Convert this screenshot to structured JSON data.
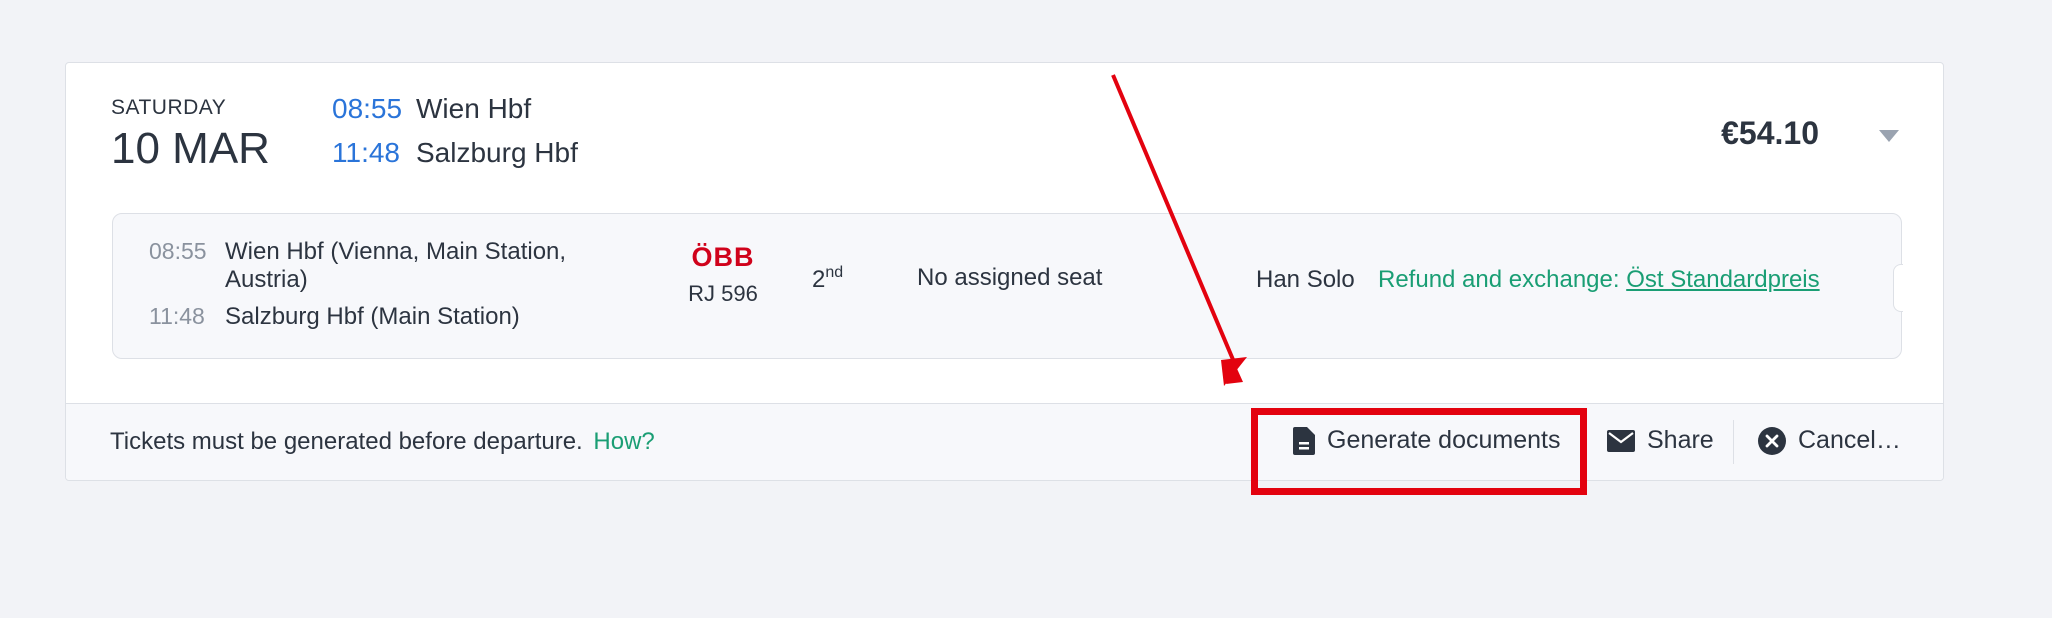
{
  "trip": {
    "weekday": "SATURDAY",
    "date": "10 MAR",
    "departure_time": "08:55",
    "departure_station": "Wien Hbf",
    "arrival_time": "11:48",
    "arrival_station": "Salzburg Hbf",
    "price": "€54.10"
  },
  "segment": {
    "dep_time": "08:55",
    "dep_station": "Wien Hbf (Vienna, Main Station, Austria)",
    "arr_time": "11:48",
    "arr_station": "Salzburg Hbf (Main Station)",
    "operator_logo": "ÖBB",
    "train_number": "RJ 596",
    "class_number": "2",
    "class_suffix": "nd",
    "seat": "No assigned seat",
    "passenger": "Han Solo",
    "refund_label": "Refund and exchange:",
    "refund_link": "Öst Standardpreis"
  },
  "footer": {
    "notice": "Tickets must be generated before departure.",
    "how_link": "How?",
    "generate_label": "Generate documents",
    "share_label": "Share",
    "cancel_label": "Cancel…"
  },
  "icons": {
    "generate": "document-icon",
    "share": "envelope-icon",
    "cancel": "close-circle-icon",
    "expand": "chevron-down-icon"
  },
  "colors": {
    "accent_time": "#2a74d9",
    "link_green": "#1a9e74",
    "obb_red": "#d0021b",
    "annotation_red": "#e3020f"
  }
}
